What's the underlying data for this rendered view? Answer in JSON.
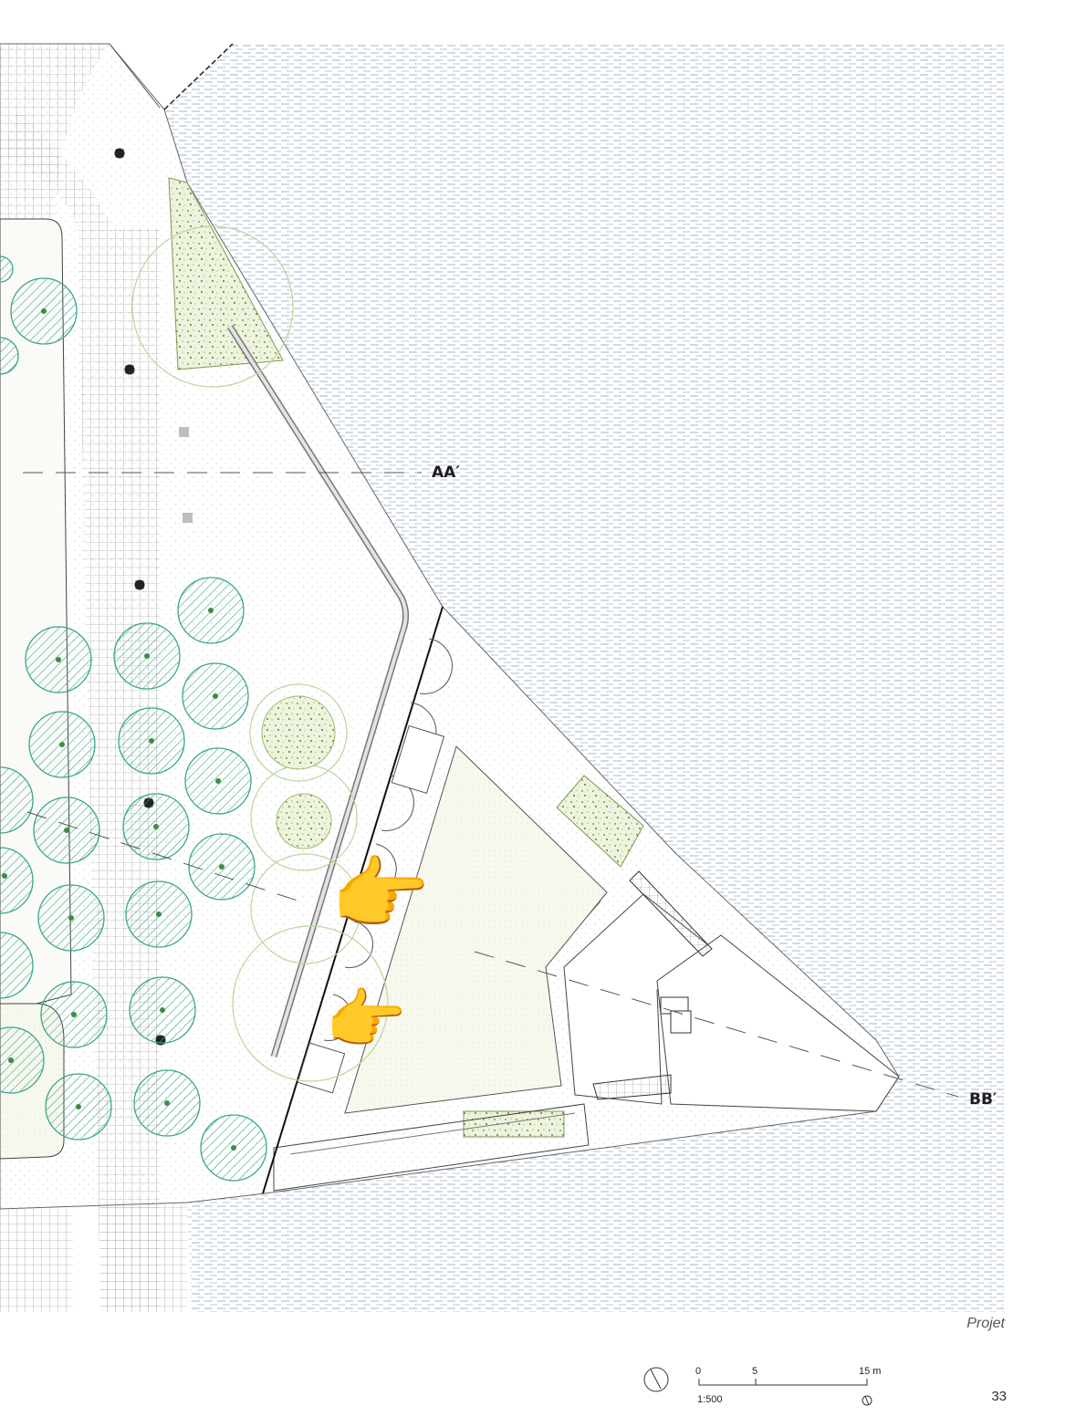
{
  "sections": [
    {
      "id": "AA",
      "label": "AA′"
    },
    {
      "id": "BB",
      "label": "BB′"
    }
  ],
  "caption": "Projet",
  "page_number": "33",
  "scale_bar": {
    "ticks": [
      "0",
      "5",
      "15 m"
    ],
    "ratio": "1:500"
  },
  "colors": {
    "water_line": "#9fb4cc",
    "tree_teal": "#3aa58f",
    "tree_green": "#8fc06a",
    "planting": "#9bbf6a",
    "paving_grid": "#8b8b8b",
    "pointer_hand": "#f6c945"
  },
  "icons": [
    "north-arrow-icon",
    "pointing-hand-icon"
  ]
}
